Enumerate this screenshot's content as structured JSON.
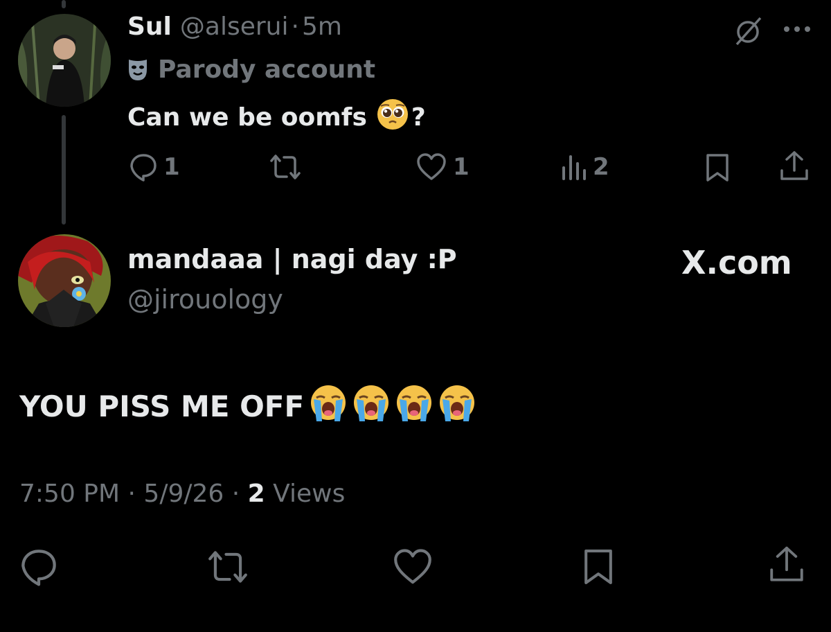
{
  "tweet1": {
    "name": "Sul",
    "handle": "@alserui",
    "separator": "·",
    "time": "5m",
    "parody_label": "Parody account",
    "text": "Can we be oomfs",
    "text_suffix": "?",
    "text_emoji": "pleading-face",
    "replies": "1",
    "likes": "1",
    "views": "2",
    "icons": [
      "grok-icon",
      "more-icon",
      "reply-icon",
      "retweet-icon",
      "like-icon",
      "views-icon",
      "bookmark-icon",
      "share-icon"
    ]
  },
  "tweet2": {
    "name": "mandaaa | nagi day :P",
    "handle": "@jirouology",
    "brand": "X.com",
    "text": "YOU PISS ME OFF",
    "text_emojis": [
      "loudly-crying-face",
      "loudly-crying-face",
      "loudly-crying-face",
      "loudly-crying-face"
    ],
    "time": "7:50 PM",
    "date": "5/9/26",
    "views_count": "2",
    "views_label": "Views",
    "separator": "·"
  },
  "colors": {
    "background": "#000000",
    "text_primary": "#e7e9ea",
    "text_secondary": "#71767b",
    "thread_line": "#333639"
  }
}
